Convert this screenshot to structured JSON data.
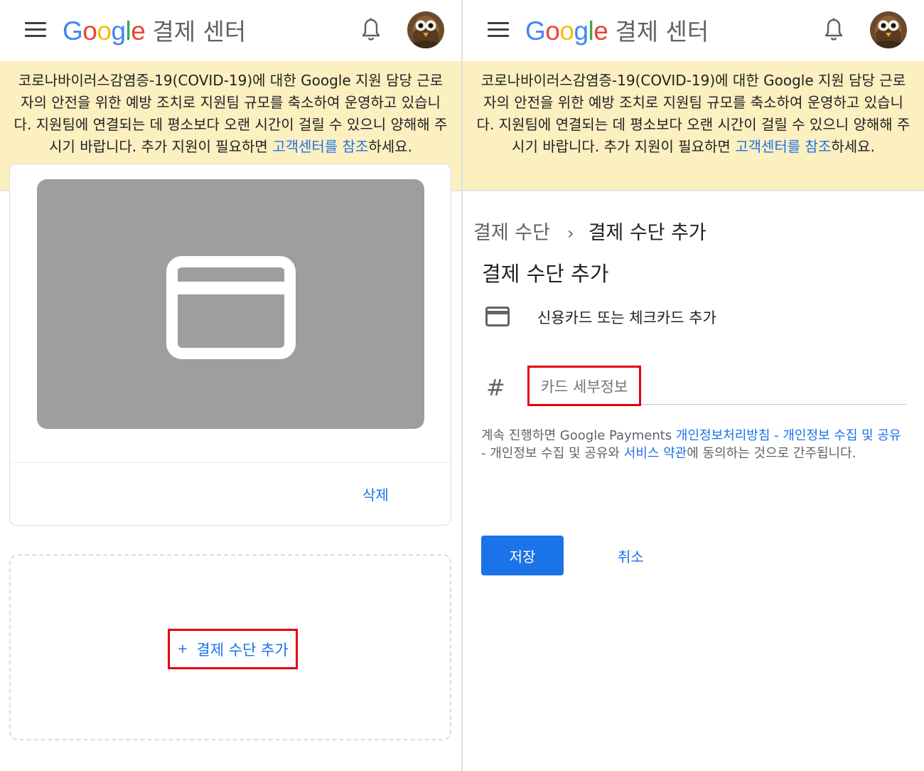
{
  "colors": {
    "google_blue": "#4285F4",
    "google_red": "#EA4335",
    "google_yellow": "#FBBC05",
    "google_green": "#34A853",
    "link": "#1a73e8",
    "notice_bg": "#fcefc0",
    "highlight_box": "#e3000f"
  },
  "header": {
    "menu_icon": "hamburger-menu-icon",
    "logo_letters": [
      "G",
      "o",
      "o",
      "g",
      "l",
      "e"
    ],
    "product_name": "결제 센터",
    "notification_icon": "bell-icon",
    "avatar_icon": "owl-avatar"
  },
  "notice": {
    "text": "코로나바이러스감염증-19(COVID-19)에 대한 Google 지원 담당 근로자의 안전을 위한 예방 조치로 지원팀 규모를 축소하여 운영하고 있습니다. 지원팀에 연결되는 데 평소보다 오랜 시간이 걸릴 수 있으니 양해해 주시기 바랍니다. 추가 지원이 필요하면 ",
    "link": "고객센터를 참조",
    "suffix": "하세요."
  },
  "left": {
    "card_icon": "credit-card-icon",
    "delete_label": "삭제",
    "add_plus": "+",
    "add_label": "결제 수단 추가"
  },
  "right": {
    "breadcrumb": {
      "parent": "결제 수단",
      "separator": "›",
      "current": "결제 수단 추가"
    },
    "title": "결제 수단 추가",
    "method_icon": "credit-card-icon",
    "method_label": "신용카드 또는 체크카드 추가",
    "hash": "#",
    "card_field_placeholder": "카드 세부정보",
    "legal": {
      "prefix": "계속 진행하면 Google Payments ",
      "link1": "개인정보처리방침 - 개인정보 수집 및 공유",
      "middle": " - 개인정보 수집 및 공유와 ",
      "link2": "서비스 약관",
      "suffix": "에 동의하는 것으로 간주됩니다."
    },
    "save_label": "저장",
    "cancel_label": "취소"
  }
}
